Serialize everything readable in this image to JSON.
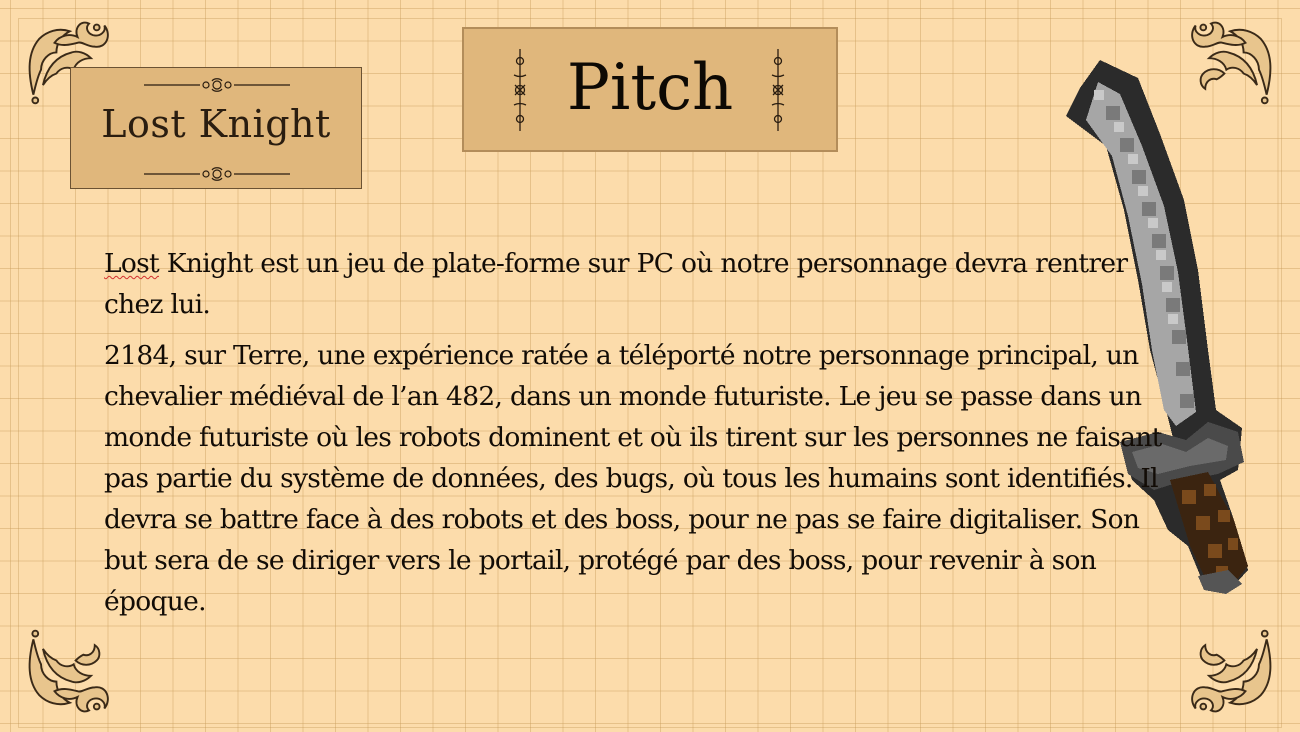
{
  "logo": {
    "text": "Lost Knight"
  },
  "title": {
    "text": "Pitch"
  },
  "body": {
    "p1_word": "Lost",
    "p1_rest": " Knight est un jeu de plate-forme sur PC où notre personnage devra rentrer chez lui.",
    "p2": "2184, sur Terre, une expérience ratée a téléporté notre personnage principal, un chevalier médiéval de l’an 482, dans un monde futuriste. Le jeu se passe dans un monde futuriste où les robots dominent et où ils tirent sur les personnes ne faisant pas partie du système de données, des bugs, où tous les humains sont identifiés. Il devra se battre face à des robots et des boss, pour ne pas se faire digitaliser. Son but sera de se diriger vers le portail, protégé par des boss, pour revenir à son époque."
  },
  "decor": {
    "corner_icon": "fleur-de-lis-ornament-icon",
    "sword_icon": "pixel-sword-icon"
  },
  "colors": {
    "background": "#fcdcab",
    "panel": "#e0b77c",
    "text": "#120c06"
  }
}
